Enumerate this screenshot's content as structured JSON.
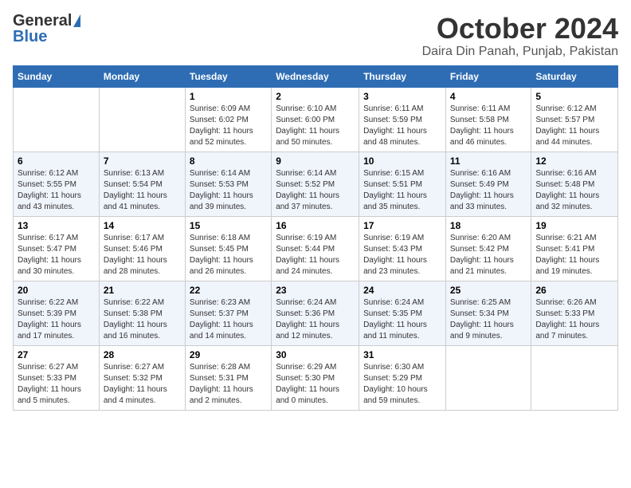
{
  "header": {
    "logo_general": "General",
    "logo_blue": "Blue",
    "month": "October 2024",
    "location": "Daira Din Panah, Punjab, Pakistan"
  },
  "weekdays": [
    "Sunday",
    "Monday",
    "Tuesday",
    "Wednesday",
    "Thursday",
    "Friday",
    "Saturday"
  ],
  "weeks": [
    [
      {
        "num": "",
        "detail": ""
      },
      {
        "num": "",
        "detail": ""
      },
      {
        "num": "1",
        "detail": "Sunrise: 6:09 AM\nSunset: 6:02 PM\nDaylight: 11 hours and 52 minutes."
      },
      {
        "num": "2",
        "detail": "Sunrise: 6:10 AM\nSunset: 6:00 PM\nDaylight: 11 hours and 50 minutes."
      },
      {
        "num": "3",
        "detail": "Sunrise: 6:11 AM\nSunset: 5:59 PM\nDaylight: 11 hours and 48 minutes."
      },
      {
        "num": "4",
        "detail": "Sunrise: 6:11 AM\nSunset: 5:58 PM\nDaylight: 11 hours and 46 minutes."
      },
      {
        "num": "5",
        "detail": "Sunrise: 6:12 AM\nSunset: 5:57 PM\nDaylight: 11 hours and 44 minutes."
      }
    ],
    [
      {
        "num": "6",
        "detail": "Sunrise: 6:12 AM\nSunset: 5:55 PM\nDaylight: 11 hours and 43 minutes."
      },
      {
        "num": "7",
        "detail": "Sunrise: 6:13 AM\nSunset: 5:54 PM\nDaylight: 11 hours and 41 minutes."
      },
      {
        "num": "8",
        "detail": "Sunrise: 6:14 AM\nSunset: 5:53 PM\nDaylight: 11 hours and 39 minutes."
      },
      {
        "num": "9",
        "detail": "Sunrise: 6:14 AM\nSunset: 5:52 PM\nDaylight: 11 hours and 37 minutes."
      },
      {
        "num": "10",
        "detail": "Sunrise: 6:15 AM\nSunset: 5:51 PM\nDaylight: 11 hours and 35 minutes."
      },
      {
        "num": "11",
        "detail": "Sunrise: 6:16 AM\nSunset: 5:49 PM\nDaylight: 11 hours and 33 minutes."
      },
      {
        "num": "12",
        "detail": "Sunrise: 6:16 AM\nSunset: 5:48 PM\nDaylight: 11 hours and 32 minutes."
      }
    ],
    [
      {
        "num": "13",
        "detail": "Sunrise: 6:17 AM\nSunset: 5:47 PM\nDaylight: 11 hours and 30 minutes."
      },
      {
        "num": "14",
        "detail": "Sunrise: 6:17 AM\nSunset: 5:46 PM\nDaylight: 11 hours and 28 minutes."
      },
      {
        "num": "15",
        "detail": "Sunrise: 6:18 AM\nSunset: 5:45 PM\nDaylight: 11 hours and 26 minutes."
      },
      {
        "num": "16",
        "detail": "Sunrise: 6:19 AM\nSunset: 5:44 PM\nDaylight: 11 hours and 24 minutes."
      },
      {
        "num": "17",
        "detail": "Sunrise: 6:19 AM\nSunset: 5:43 PM\nDaylight: 11 hours and 23 minutes."
      },
      {
        "num": "18",
        "detail": "Sunrise: 6:20 AM\nSunset: 5:42 PM\nDaylight: 11 hours and 21 minutes."
      },
      {
        "num": "19",
        "detail": "Sunrise: 6:21 AM\nSunset: 5:41 PM\nDaylight: 11 hours and 19 minutes."
      }
    ],
    [
      {
        "num": "20",
        "detail": "Sunrise: 6:22 AM\nSunset: 5:39 PM\nDaylight: 11 hours and 17 minutes."
      },
      {
        "num": "21",
        "detail": "Sunrise: 6:22 AM\nSunset: 5:38 PM\nDaylight: 11 hours and 16 minutes."
      },
      {
        "num": "22",
        "detail": "Sunrise: 6:23 AM\nSunset: 5:37 PM\nDaylight: 11 hours and 14 minutes."
      },
      {
        "num": "23",
        "detail": "Sunrise: 6:24 AM\nSunset: 5:36 PM\nDaylight: 11 hours and 12 minutes."
      },
      {
        "num": "24",
        "detail": "Sunrise: 6:24 AM\nSunset: 5:35 PM\nDaylight: 11 hours and 11 minutes."
      },
      {
        "num": "25",
        "detail": "Sunrise: 6:25 AM\nSunset: 5:34 PM\nDaylight: 11 hours and 9 minutes."
      },
      {
        "num": "26",
        "detail": "Sunrise: 6:26 AM\nSunset: 5:33 PM\nDaylight: 11 hours and 7 minutes."
      }
    ],
    [
      {
        "num": "27",
        "detail": "Sunrise: 6:27 AM\nSunset: 5:33 PM\nDaylight: 11 hours and 5 minutes."
      },
      {
        "num": "28",
        "detail": "Sunrise: 6:27 AM\nSunset: 5:32 PM\nDaylight: 11 hours and 4 minutes."
      },
      {
        "num": "29",
        "detail": "Sunrise: 6:28 AM\nSunset: 5:31 PM\nDaylight: 11 hours and 2 minutes."
      },
      {
        "num": "30",
        "detail": "Sunrise: 6:29 AM\nSunset: 5:30 PM\nDaylight: 11 hours and 0 minutes."
      },
      {
        "num": "31",
        "detail": "Sunrise: 6:30 AM\nSunset: 5:29 PM\nDaylight: 10 hours and 59 minutes."
      },
      {
        "num": "",
        "detail": ""
      },
      {
        "num": "",
        "detail": ""
      }
    ]
  ]
}
